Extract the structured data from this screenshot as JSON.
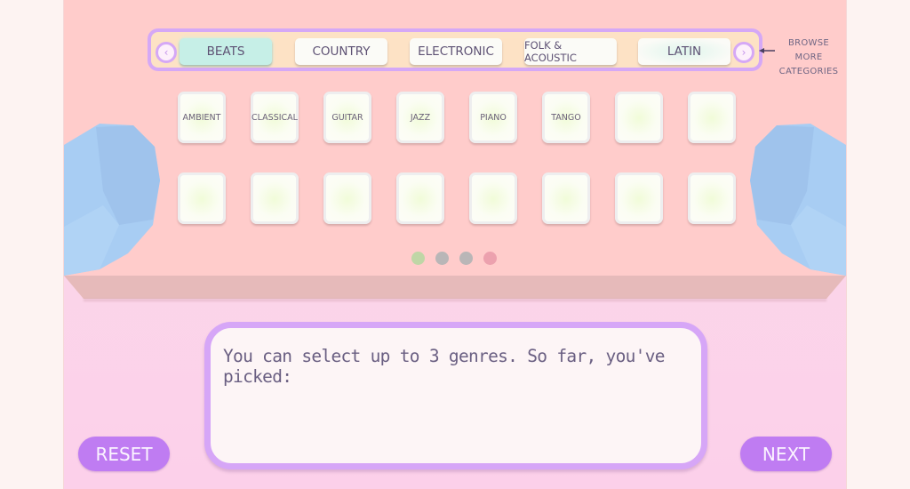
{
  "categories": {
    "prev_label": "‹",
    "next_label": "›",
    "items": [
      {
        "label": "BEATS",
        "selected": true
      },
      {
        "label": "COUNTRY",
        "selected": false
      },
      {
        "label": "ELECTRONIC",
        "selected": false
      },
      {
        "label": "FOLK & ACOUSTIC",
        "selected": false
      },
      {
        "label": "LATIN",
        "selected": false
      }
    ],
    "browse_hint_line1": "BROWSE MORE",
    "browse_hint_line2": "CATEGORIES"
  },
  "pads": {
    "row1": [
      "AMBIENT",
      "CLASSICAL",
      "GUITAR",
      "JAZZ",
      "PIANO",
      "TANGO",
      "",
      ""
    ],
    "row2": [
      "",
      "",
      "",
      "",
      "",
      "",
      "",
      ""
    ]
  },
  "page_indicator": {
    "total": 4,
    "colors": [
      "#bfd6a6",
      "#b9b6b7",
      "#b9b6b7",
      "#eca1ae"
    ]
  },
  "message": {
    "text": "You can select up to 3 genres. So far, you've picked:",
    "picked": []
  },
  "buttons": {
    "reset": "RESET",
    "next": "NEXT"
  },
  "colors": {
    "accent_purple": "#bf7cf2",
    "frame_purple": "#d6a6f7",
    "board_pink": "#ffcccb",
    "selected_teal": "#c6efe7",
    "hand_blue": "#a8cdf3"
  }
}
